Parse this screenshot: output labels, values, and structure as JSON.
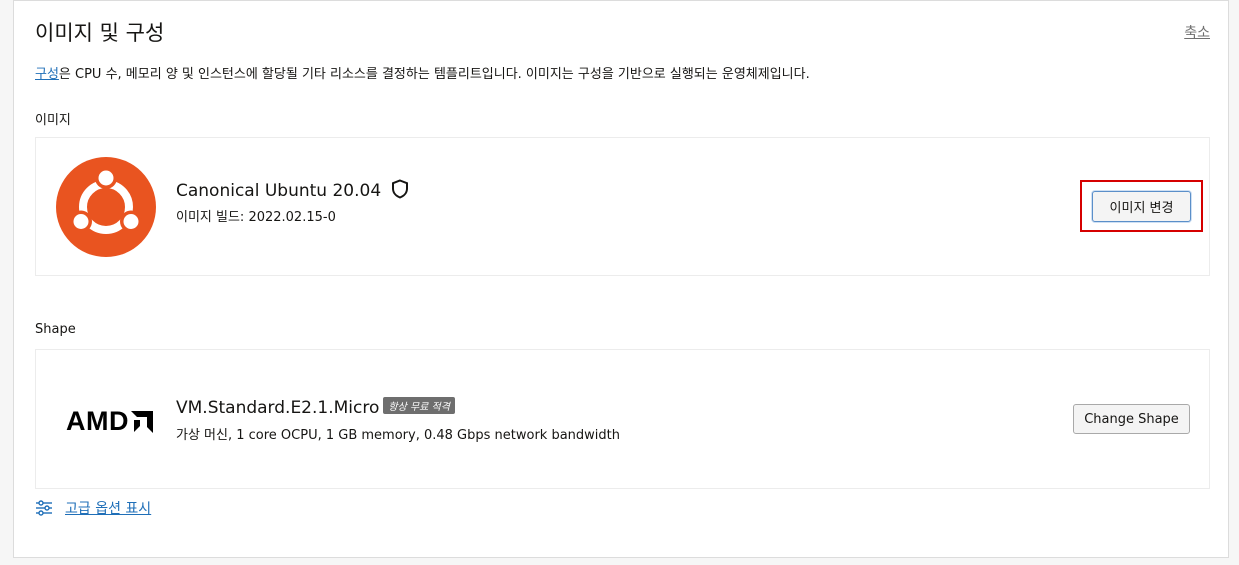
{
  "header": {
    "title": "이미지 및 구성",
    "collapse_label": "축소"
  },
  "description": {
    "link_text": "구성",
    "text": "은 CPU 수, 메모리 양 및 인스턴스에 할당될 기타 리소스를 결정하는 템플리트입니다. 이미지는 구성을 기반으로 실행되는 운영체제입니다."
  },
  "image_section": {
    "label": "이미지",
    "name": "Canonical Ubuntu 20.04",
    "build": "이미지 빌드: 2022.02.15-0",
    "change_button": "이미지 변경",
    "logo_icon": "ubuntu-logo",
    "status_icon": "shield-icon"
  },
  "shape_section": {
    "label": "Shape",
    "name": "VM.Standard.E2.1.Micro",
    "badge": "항상 무료 적격",
    "spec": "가상 머신, 1 core OCPU, 1 GB memory, 0.48 Gbps network bandwidth",
    "vendor_logo_text": "AMD",
    "change_button": "Change Shape"
  },
  "advanced": {
    "label": "고급 옵션 표시",
    "icon": "sliders-icon"
  },
  "colors": {
    "link": "#1f6fb8",
    "ubuntu_orange": "#e95420",
    "highlight": "#d60000"
  }
}
